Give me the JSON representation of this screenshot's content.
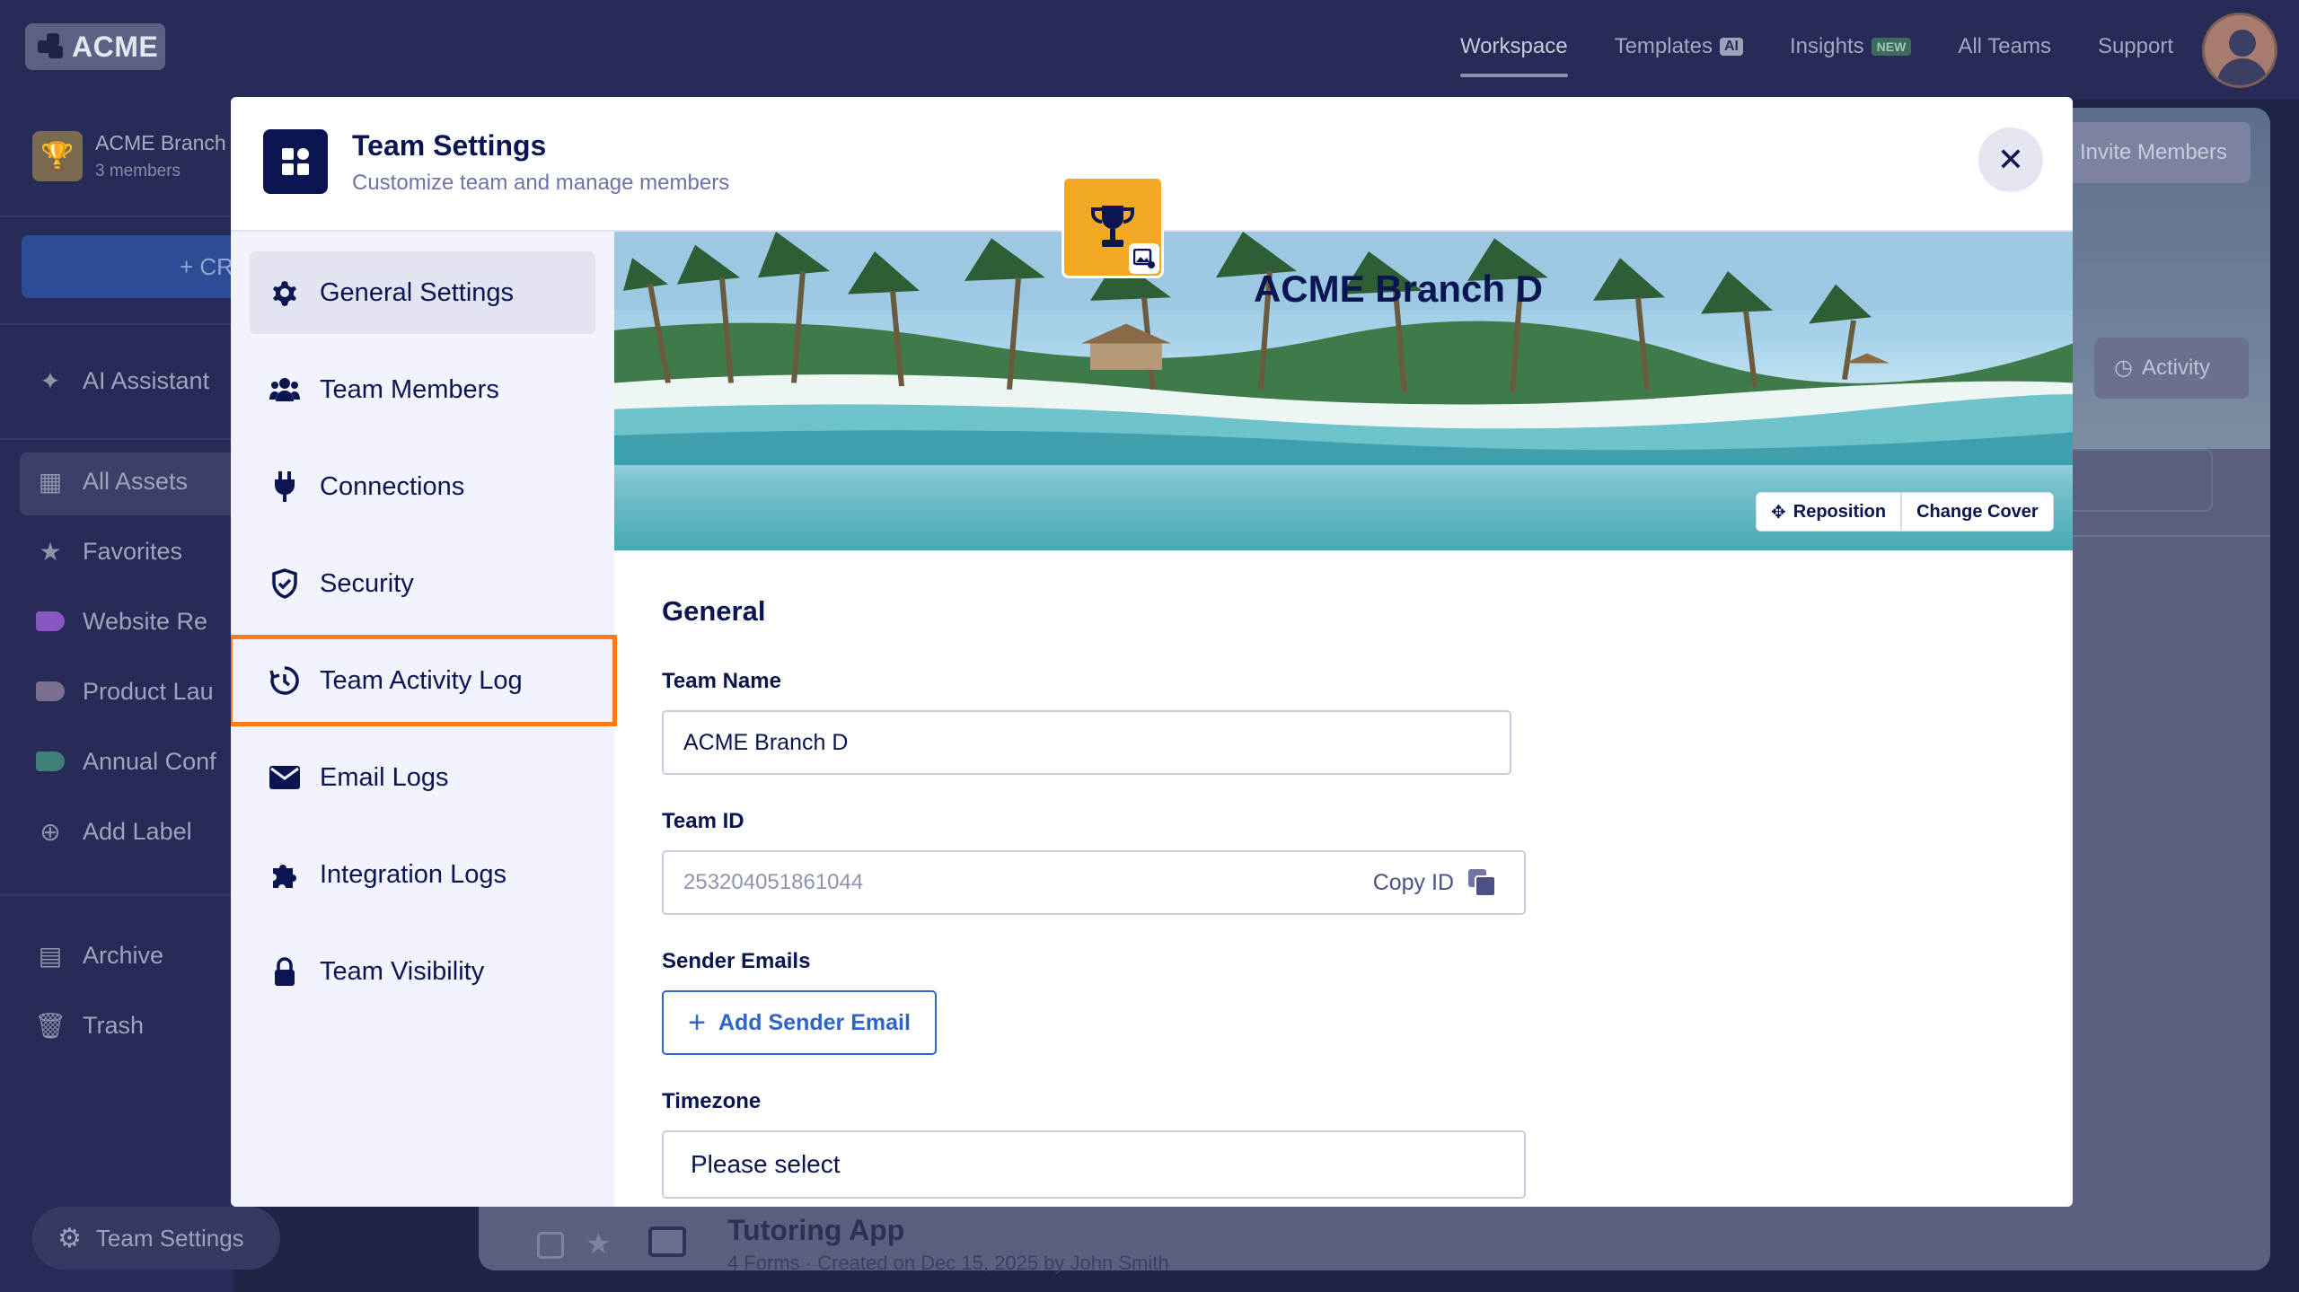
{
  "app": {
    "logo_text": "ACME",
    "topnav": [
      {
        "label": "Workspace"
      },
      {
        "label": "Templates",
        "tag": "AI"
      },
      {
        "label": "Insights",
        "tag": "NEW"
      },
      {
        "label": "All Teams"
      },
      {
        "label": "Support"
      }
    ],
    "team_name": "ACME Branch",
    "team_members": "3 members",
    "create_label": "+ CR",
    "sidebar": {
      "ai_assistant": "AI Assistant",
      "all_assets": "All Assets",
      "favorites": "Favorites",
      "labels": [
        {
          "label": "Website Re",
          "color": "#8a56c4"
        },
        {
          "label": "Product Lau",
          "color": "#7b6f8f"
        },
        {
          "label": "Annual Conf",
          "color": "#3f7f77"
        }
      ],
      "add_label": "Add Label",
      "archive": "Archive",
      "trash": "Trash"
    },
    "invite_label": "Invite Members",
    "activity_label": "Activity",
    "form_row": {
      "title": "Tutoring App",
      "subtitle": "4 Forms · Created on Dec 15, 2025 by John Smith"
    },
    "team_settings_pill": "Team Settings"
  },
  "modal": {
    "title": "Team Settings",
    "subtitle": "Customize team and manage members",
    "close_icon": "close-icon",
    "nav": [
      {
        "label": "General Settings",
        "icon": "gear-icon"
      },
      {
        "label": "Team Members",
        "icon": "users-icon"
      },
      {
        "label": "Connections",
        "icon": "plug-icon"
      },
      {
        "label": "Security",
        "icon": "shield-icon"
      },
      {
        "label": "Team Activity Log",
        "icon": "clock-history-icon"
      },
      {
        "label": "Email Logs",
        "icon": "envelope-icon"
      },
      {
        "label": "Integration Logs",
        "icon": "puzzle-icon"
      },
      {
        "label": "Team Visibility",
        "icon": "lock-icon"
      }
    ],
    "cover": {
      "team_name": "ACME Branch D",
      "reposition": "Reposition",
      "change_cover": "Change Cover"
    },
    "general": {
      "section_title": "General",
      "team_name_label": "Team Name",
      "team_name_value": "ACME Branch D",
      "team_id_label": "Team ID",
      "team_id_value": "253204051861044",
      "copy_id_label": "Copy ID",
      "sender_emails_label": "Sender Emails",
      "add_sender_label": "Add Sender Email",
      "timezone_label": "Timezone",
      "timezone_value": "Please select"
    }
  },
  "colors": {
    "accent": "#2d66c8",
    "highlight": "#ff7a1a",
    "navy": "#0a1551"
  }
}
